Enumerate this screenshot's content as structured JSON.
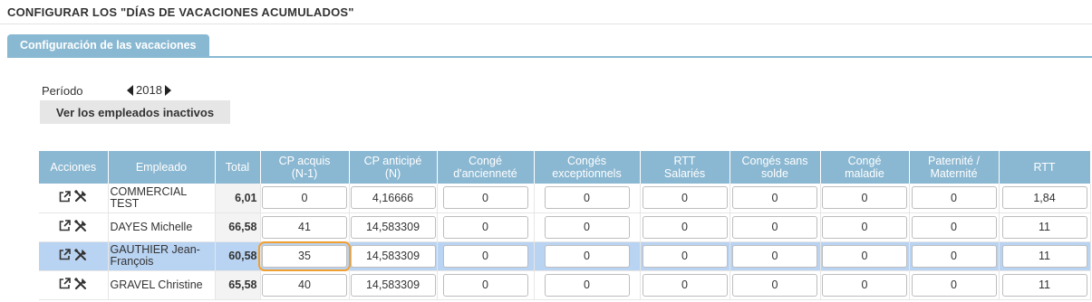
{
  "page": {
    "title": "CONFIGURAR LOS \"DÍAS DE VACACIONES ACUMULADOS\"",
    "tab_label": "Configuración de las vacaciones"
  },
  "period": {
    "label": "Período",
    "year": "2018"
  },
  "inactive_button": "Ver los empleados inactivos",
  "table": {
    "headers": {
      "acciones": "Acciones",
      "empleado": "Empleado",
      "total": "Total",
      "cp_acquis_1": "CP acquis",
      "cp_acquis_2": "(N-1)",
      "cp_anticipe_1": "CP anticipé",
      "cp_anticipe_2": "(N)",
      "conge_anc_1": "Congé",
      "conge_anc_2": "d'ancienneté",
      "conges_exc_1": "Congés",
      "conges_exc_2": "exceptionnels",
      "rtt_sal_1": "RTT",
      "rtt_sal_2": "Salariés",
      "sans_solde_1": "Congés sans",
      "sans_solde_2": "solde",
      "maladie_1": "Congé",
      "maladie_2": "maladie",
      "paternite_1": "Paternité /",
      "paternite_2": "Maternité",
      "rtt": "RTT"
    },
    "rows": [
      {
        "name_1": "COMMERCIAL",
        "name_2": "TEST",
        "total": "6,01",
        "values": [
          "0",
          "4,16666",
          "0",
          "0",
          "0",
          "0",
          "0",
          "0",
          "1,84"
        ]
      },
      {
        "name_1": "DAYES Michelle",
        "name_2": "",
        "total": "66,58",
        "values": [
          "41",
          "14,583309",
          "0",
          "0",
          "0",
          "0",
          "0",
          "0",
          "11"
        ]
      },
      {
        "name_1": "GAUTHIER Jean-",
        "name_2": "François",
        "total": "60,58",
        "values": [
          "35",
          "14,583309",
          "0",
          "0",
          "0",
          "0",
          "0",
          "0",
          "11"
        ]
      },
      {
        "name_1": "GRAVEL Christine",
        "name_2": "",
        "total": "65,58",
        "values": [
          "40",
          "14,583309",
          "0",
          "0",
          "0",
          "0",
          "0",
          "0",
          "11"
        ]
      }
    ]
  },
  "icons": {
    "edit": "external-link-icon",
    "settings": "tools-icon"
  },
  "colors": {
    "header_blue": "#8ab7d1",
    "selected_row": "#b9d3f2",
    "focus_outline": "#f0a030"
  }
}
